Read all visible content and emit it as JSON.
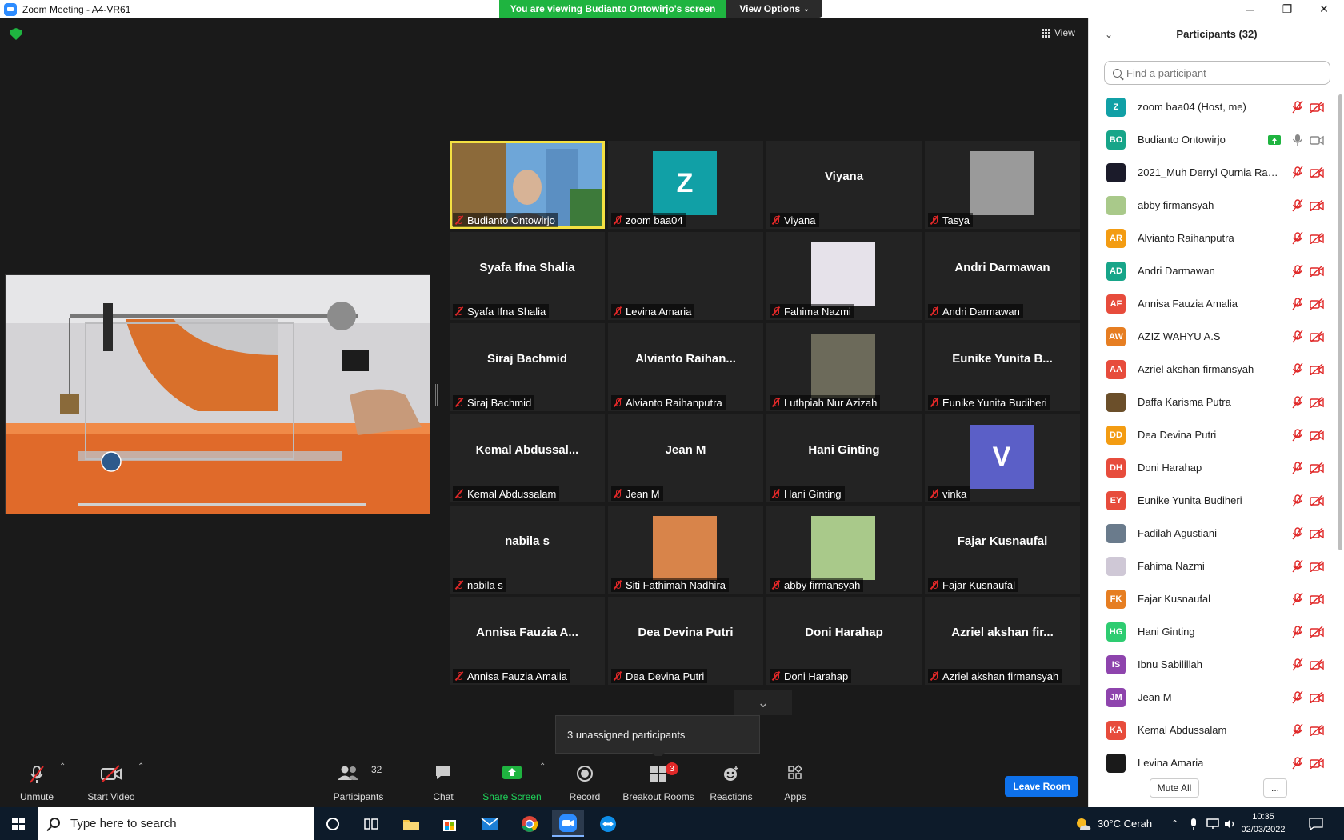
{
  "window": {
    "title": "Zoom Meeting - A4-VR61",
    "minimize": "─",
    "maximize": "❐",
    "close": "✕"
  },
  "banner": {
    "viewing_text": "You are viewing Budianto Ontowirjo's screen",
    "view_options": "View Options"
  },
  "view_label": "View",
  "tiles": [
    {
      "big": "",
      "label": "Budianto Ontowirjo",
      "kind": "video",
      "active": true
    },
    {
      "big": "",
      "label": "zoom baa04",
      "kind": "letter",
      "letter": "Z",
      "color": "#11a0a6"
    },
    {
      "big": "Viyana",
      "label": "Viyana",
      "kind": "name"
    },
    {
      "big": "",
      "label": "Tasya",
      "kind": "photo",
      "color": "#9a9a9a"
    },
    {
      "big": "Syafa Ifna Shalia",
      "label": "Syafa Ifna Shalia",
      "kind": "name"
    },
    {
      "big": "",
      "label": "Levina Amaria",
      "kind": "blank"
    },
    {
      "big": "",
      "label": "Fahima Nazmi",
      "kind": "photo",
      "color": "#e6e2ea"
    },
    {
      "big": "Andri Darmawan",
      "label": "Andri Darmawan",
      "kind": "name"
    },
    {
      "big": "Siraj Bachmid",
      "label": "Siraj Bachmid",
      "kind": "name"
    },
    {
      "big": "Alvianto  Raihan...",
      "label": "Alvianto Raihanputra",
      "kind": "name"
    },
    {
      "big": "",
      "label": "Luthpiah Nur Azizah",
      "kind": "photo",
      "color": "#6c6a5a"
    },
    {
      "big": "Eunike  Yunita  B...",
      "label": "Eunike Yunita Budiheri",
      "kind": "name"
    },
    {
      "big": "Kemal  Abdussal...",
      "label": "Kemal Abdussalam",
      "kind": "name"
    },
    {
      "big": "Jean M",
      "label": "Jean M",
      "kind": "name"
    },
    {
      "big": "Hani Ginting",
      "label": "Hani Ginting",
      "kind": "name"
    },
    {
      "big": "",
      "label": "vinka",
      "kind": "letter",
      "letter": "V",
      "color": "#5b5fc7"
    },
    {
      "big": "nabila s",
      "label": "nabila s",
      "kind": "name"
    },
    {
      "big": "",
      "label": "Siti Fathimah Nadhira",
      "kind": "photo",
      "color": "#d8844a"
    },
    {
      "big": "",
      "label": "abby firmansyah",
      "kind": "photo",
      "color": "#a9c98a"
    },
    {
      "big": "Fajar Kusnaufal",
      "label": "Fajar Kusnaufal",
      "kind": "name"
    },
    {
      "big": "Annisa  Fauzia  A...",
      "label": "Annisa Fauzia Amalia",
      "kind": "name"
    },
    {
      "big": "Dea Devina Putri",
      "label": "Dea Devina Putri",
      "kind": "name"
    },
    {
      "big": "Doni Harahap",
      "label": "Doni Harahap",
      "kind": "name"
    },
    {
      "big": "Azriel  akshan  fir...",
      "label": "Azriel akshan firmansyah",
      "kind": "name"
    }
  ],
  "unassigned": "3 unassigned participants",
  "toolbar": {
    "unmute": "Unmute",
    "start_video": "Start Video",
    "participants": "Participants",
    "participants_count": "32",
    "chat": "Chat",
    "share_screen": "Share Screen",
    "record": "Record",
    "breakout": "Breakout Rooms",
    "breakout_badge": "3",
    "reactions": "Reactions",
    "apps": "Apps",
    "leave": "Leave Room"
  },
  "panel": {
    "title": "Participants (32)",
    "search_placeholder": "Find a participant",
    "mute_all": "Mute All",
    "more": "...",
    "participants": [
      {
        "initials": "Z",
        "name": "zoom baa04 (Host, me)",
        "color": "#11a0a6",
        "status": "muted"
      },
      {
        "initials": "BO",
        "name": "Budianto Ontowirjo",
        "color": "#17a589",
        "status": "sharing"
      },
      {
        "initials": "",
        "name": "2021_Muh Derryl Qurnia Rama...",
        "color": "#1b1b2a",
        "status": "muted"
      },
      {
        "initials": "",
        "name": "abby firmansyah",
        "color": "#a9c98a",
        "status": "muted"
      },
      {
        "initials": "AR",
        "name": "Alvianto Raihanputra",
        "color": "#f39c12",
        "status": "muted"
      },
      {
        "initials": "AD",
        "name": "Andri Darmawan",
        "color": "#17a589",
        "status": "muted"
      },
      {
        "initials": "AF",
        "name": "Annisa Fauzia Amalia",
        "color": "#e74c3c",
        "status": "muted"
      },
      {
        "initials": "AW",
        "name": "AZIZ WAHYU A.S",
        "color": "#e67e22",
        "status": "muted"
      },
      {
        "initials": "AA",
        "name": "Azriel akshan firmansyah",
        "color": "#e74c3c",
        "status": "muted"
      },
      {
        "initials": "",
        "name": "Daffa Karisma Putra",
        "color": "#6b4f2a",
        "status": "muted"
      },
      {
        "initials": "DD",
        "name": "Dea Devina Putri",
        "color": "#f39c12",
        "status": "muted"
      },
      {
        "initials": "DH",
        "name": "Doni Harahap",
        "color": "#e74c3c",
        "status": "muted"
      },
      {
        "initials": "EY",
        "name": "Eunike Yunita Budiheri",
        "color": "#e74c3c",
        "status": "muted"
      },
      {
        "initials": "",
        "name": "Fadilah Agustiani",
        "color": "#6a7b8c",
        "status": "muted"
      },
      {
        "initials": "",
        "name": "Fahima Nazmi",
        "color": "#cfc8d6",
        "status": "muted"
      },
      {
        "initials": "FK",
        "name": "Fajar Kusnaufal",
        "color": "#e67e22",
        "status": "muted"
      },
      {
        "initials": "HG",
        "name": "Hani Ginting",
        "color": "#2ecc71",
        "status": "muted"
      },
      {
        "initials": "IS",
        "name": "Ibnu Sabilillah",
        "color": "#8e44ad",
        "status": "muted"
      },
      {
        "initials": "JM",
        "name": "Jean M",
        "color": "#8e44ad",
        "status": "muted"
      },
      {
        "initials": "KA",
        "name": "Kemal Abdussalam",
        "color": "#e74c3c",
        "status": "muted"
      },
      {
        "initials": "",
        "name": "Levina Amaria",
        "color": "#1a1a1a",
        "status": "muted"
      }
    ]
  },
  "taskbar": {
    "search_placeholder": "Type here to search",
    "weather": "30°C  Cerah",
    "time": "10:35",
    "date": "02/03/2022"
  }
}
